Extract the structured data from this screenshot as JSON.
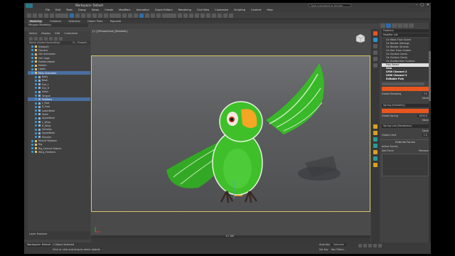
{
  "window": {
    "title": "Workspace: Default",
    "search_placeholder": "Type a keyword or phrase",
    "controls": [
      "–",
      "▢",
      "✕"
    ]
  },
  "menubar": [
    "File",
    "Edit",
    "Tools",
    "Group",
    "Views",
    "Create",
    "Modifiers",
    "Animation",
    "Graph Editors",
    "Rendering",
    "Civil View",
    "Customize",
    "Scripting",
    "Content",
    "Help"
  ],
  "ribbon": {
    "tabs": [
      "Modeling",
      "Freeform",
      "Selection",
      "Object Paint",
      "Populate"
    ],
    "active_tab": "Modeling",
    "sub": "Polygon Modeling"
  },
  "scene_explorer": {
    "menu": [
      "Select",
      "Display",
      "Edit",
      "Customize"
    ],
    "column_name": "Name (Sorted Ascending)",
    "column_props": "Fr... Propert...",
    "rows": [
      {
        "label": "(Default)",
        "indent": 1,
        "type": "layer"
      },
      {
        "label": "Camera",
        "indent": 1,
        "type": "layer"
      },
      {
        "label": "Cell Animation",
        "indent": 1,
        "type": "layer"
      },
      {
        "label": "Cell Cage",
        "indent": 1,
        "type": "layer"
      },
      {
        "label": "FreeformNode",
        "indent": 1,
        "type": "layer"
      },
      {
        "label": "Hidden",
        "indent": 1,
        "type": "layer"
      },
      {
        "label": "Lights",
        "indent": 1,
        "type": "layer"
      },
      {
        "label": "Main Character",
        "indent": 1,
        "type": "layer",
        "highlight": true
      },
      {
        "label": "Body",
        "indent": 2,
        "type": "obj"
      },
      {
        "label": "Beak",
        "indent": 2,
        "type": "obj"
      },
      {
        "label": "Eye_L",
        "indent": 2,
        "type": "obj"
      },
      {
        "label": "Eye_R",
        "indent": 2,
        "type": "obj"
      },
      {
        "label": "Head",
        "indent": 2,
        "type": "obj"
      },
      {
        "label": "Tongue",
        "indent": 2,
        "type": "obj"
      },
      {
        "label": "Feathers",
        "indent": 2,
        "type": "obj",
        "highlight": true
      },
      {
        "label": "L_Foot",
        "indent": 2,
        "type": "obj"
      },
      {
        "label": "R_Foot",
        "indent": 2,
        "type": "obj"
      },
      {
        "label": "LowerBeak",
        "indent": 2,
        "type": "obj"
      },
      {
        "label": "Teeth",
        "indent": 2,
        "type": "obj"
      },
      {
        "label": "UpperBeak",
        "indent": 2,
        "type": "obj"
      },
      {
        "label": "L_Wing",
        "indent": 2,
        "type": "obj"
      },
      {
        "label": "R_Wing",
        "indent": 2,
        "type": "obj"
      },
      {
        "label": "Skeleton",
        "indent": 2,
        "type": "obj"
      },
      {
        "label": "UpperBeak",
        "indent": 2,
        "type": "obj"
      },
      {
        "label": "Muscles",
        "indent": 2,
        "type": "obj"
      },
      {
        "label": "Muscle Rotation",
        "indent": 1,
        "type": "layer"
      },
      {
        "label": "Rig",
        "indent": 1,
        "type": "layer"
      },
      {
        "label": "Rig_Control Objects",
        "indent": 1,
        "type": "layer"
      },
      {
        "label": "Wing_Feathers",
        "indent": 1,
        "type": "layer"
      }
    ],
    "layer_footer": "Layer Explorer"
  },
  "viewport": {
    "label": "[+] [Perspective] [Realistic]",
    "frame_count": "0 / 100"
  },
  "command_panel": {
    "object_name": "Feathers",
    "modifier_list_label": "Modifier List",
    "modifiers": [
      {
        "label": "Ox Mesh Flow Solver",
        "sel": false
      },
      {
        "label": "Ox Render Settings",
        "sel": false
      },
      {
        "label": "Ox Render Strands",
        "sel": false
      },
      {
        "label": "Ox Hair From Guides",
        "sel": false
      },
      {
        "label": "Ox Surface Comb",
        "sel": false
      },
      {
        "label": "Ox Surface Comb",
        "sel": false
      },
      {
        "label": "Ox Guides from Surface",
        "sel": false
      },
      {
        "label": "Poly Select",
        "sel": true
      },
      {
        "label": "Skin",
        "sel": false,
        "bold": true
      },
      {
        "label": "UVW Channel 2",
        "sel": false,
        "bold": true
      },
      {
        "label": "UVW Channel 3",
        "sel": false,
        "bold": true
      },
      {
        "label": "Editable Poly",
        "sel": false,
        "bold": true
      }
    ],
    "params": [
      {
        "label": "Global Damping",
        "value": "0.0"
      },
      {
        "label": "Spring (Flexibility)",
        "value": ""
      },
      {
        "label": "Global Spring",
        "value": "1000.0"
      },
      {
        "label": "Spring Link (Bendiness)",
        "value": ""
      },
      {
        "label": "Global Limit",
        "value": "1.0"
      }
    ],
    "none_label": "None",
    "section_external": "External Forces",
    "active_forces": "Active Forces",
    "add_force": "Add Force",
    "remove_label": "Remove"
  },
  "statusbar": {
    "workspace": "Workspace: Default",
    "status1": "1 Object Selected",
    "status2": "Click or click-and-drag to select objects",
    "auto_key": "Auto Key",
    "selected": "Selected",
    "set_key": "Set Key",
    "key_filters": "Key Filters..."
  },
  "colors": {
    "accent_orange": "#e8561e",
    "selection_blue": "#4b6ea0",
    "viewport_border": "#d9c76a",
    "parrot_green": "#3fbf2a",
    "beak_orange": "#f5a623"
  }
}
